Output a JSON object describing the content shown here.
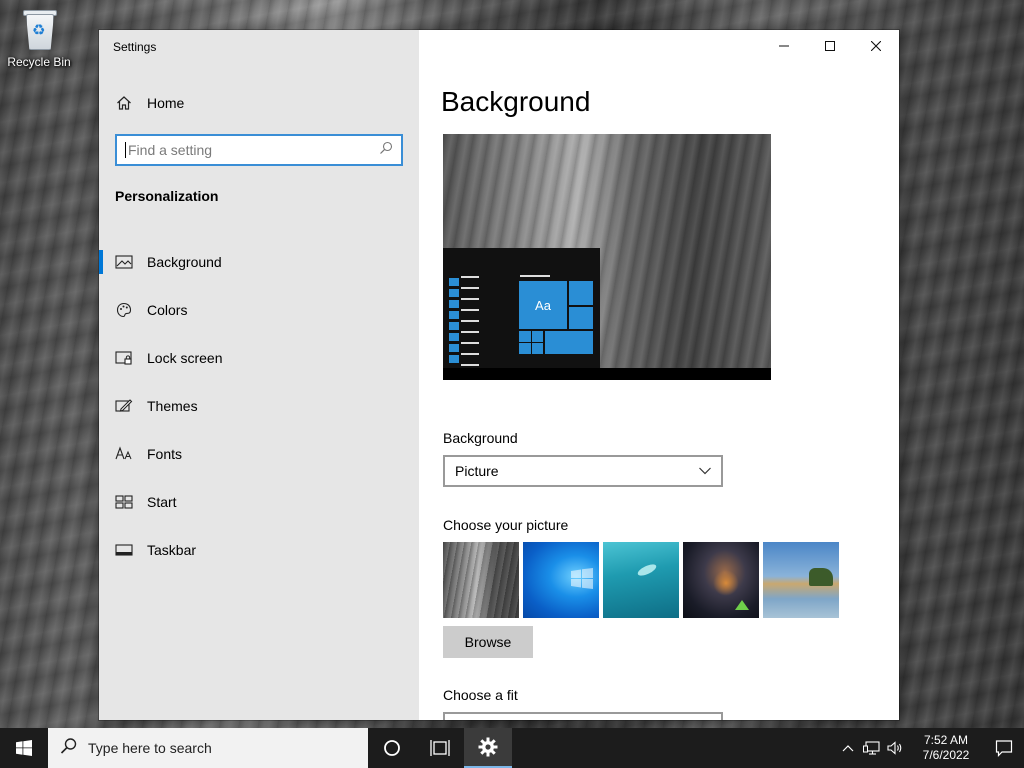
{
  "desktop": {
    "icons": [
      {
        "label": "Recycle Bin",
        "icon": "recycle-bin-icon"
      }
    ]
  },
  "window": {
    "app_title": "Settings",
    "controls": {
      "minimize": "minimize-icon",
      "maximize": "maximize-icon",
      "close": "close-icon"
    }
  },
  "sidebar": {
    "home_label": "Home",
    "search_placeholder": "Find a setting",
    "section_title": "Personalization",
    "items": [
      {
        "label": "Background",
        "icon": "picture-icon",
        "active": true
      },
      {
        "label": "Colors",
        "icon": "palette-icon",
        "active": false
      },
      {
        "label": "Lock screen",
        "icon": "lock-screen-icon",
        "active": false
      },
      {
        "label": "Themes",
        "icon": "themes-icon",
        "active": false
      },
      {
        "label": "Fonts",
        "icon": "fonts-icon",
        "active": false
      },
      {
        "label": "Start",
        "icon": "start-icon",
        "active": false
      },
      {
        "label": "Taskbar",
        "icon": "taskbar-icon",
        "active": false
      }
    ]
  },
  "main": {
    "title": "Background",
    "preview_tile_text": "Aa",
    "background_label": "Background",
    "background_value": "Picture",
    "choose_picture_label": "Choose your picture",
    "browse_label": "Browse",
    "choose_fit_label": "Choose a fit"
  },
  "taskbar": {
    "search_placeholder": "Type here to search",
    "time": "7:52 AM",
    "date": "7/6/2022"
  },
  "colors": {
    "accent": "#0078d7",
    "sidebar_bg": "#e6e6e6",
    "taskbar_bg": "#1c1c1c"
  }
}
